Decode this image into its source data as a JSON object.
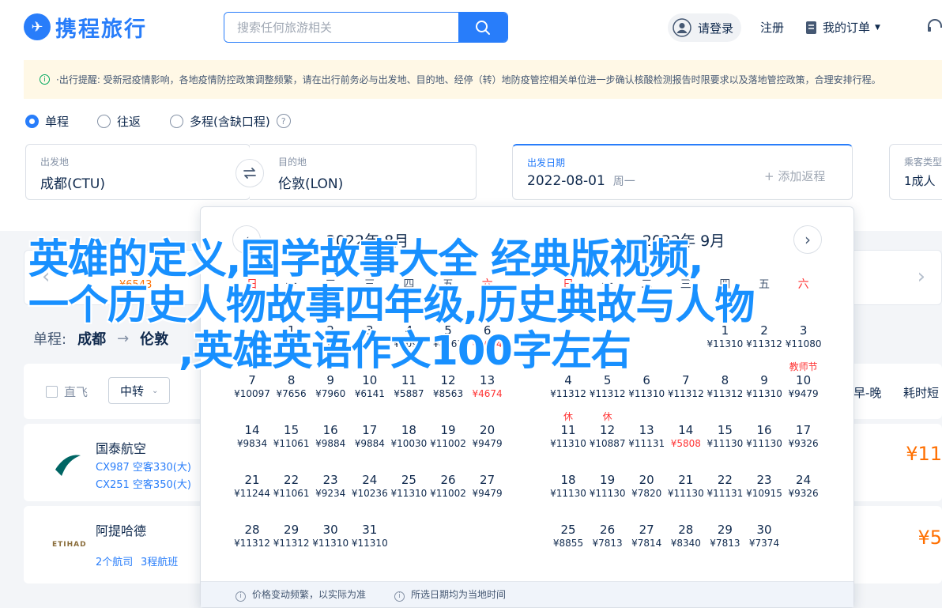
{
  "header": {
    "logo_text": "携程旅行",
    "search_placeholder": "搜索任何旅游相关",
    "login_label": "请登录",
    "register_label": "注册",
    "orders_label": "我的订单"
  },
  "notice": {
    "text": "·出行提醒: 受新冠疫情影响，各地疫情防控政策调整频繁，请在出行前务必与出发地、目的地、经停（转）地防疫管控相关单位进一步确认核酸检测报告时限要求以及落地管控政策，合理安排行程。"
  },
  "trip_type": {
    "options": [
      "单程",
      "往返",
      "多程(含缺口程)"
    ],
    "selected": "单程"
  },
  "search_form": {
    "from_label": "出发地",
    "from_value": "成都(CTU)",
    "to_label": "目的地",
    "to_value": "伦敦(LON)",
    "date_label": "出发日期",
    "date_value": "2022-08-01",
    "date_weekday": "周一",
    "add_return": "+ 添加返程",
    "passengers_label": "乘客类型",
    "passengers_value": "1成人"
  },
  "background": {
    "strip_price": "¥6543",
    "summary_prefix": "单程:",
    "summary_from": "成都",
    "summary_to": "伦敦",
    "filter_direct": "直飞",
    "filter_transfer": "中转",
    "sort_early_late": "早-晚",
    "sort_duration": "耗时短",
    "flights": [
      {
        "airline": "国泰航空",
        "line1": "CX987 空客330(大)",
        "line2": "CX251 空客350(大)",
        "price": "¥11"
      },
      {
        "airline": "阿提哈德",
        "line1": "2个航司",
        "line2": "3程航班",
        "price": "¥5"
      }
    ]
  },
  "calendar": {
    "months": [
      {
        "title": "2022年 8月",
        "weekdays": [
          "日",
          "一",
          "二",
          "三",
          "四",
          "五",
          "六"
        ],
        "first_weekday": 1,
        "days": [
          {
            "d": "1",
            "p": "¥",
            "low": false
          },
          {
            "d": "2",
            "p": "¥",
            "low": false
          },
          {
            "d": "3",
            "p": "¥",
            "low": false
          },
          {
            "d": "4",
            "p": "¥5098",
            "low": false
          },
          {
            "d": "5",
            "p": "¥8563",
            "low": false
          },
          {
            "d": "6",
            "p": "¥4674",
            "low": true
          },
          {
            "d": "7",
            "p": "¥10097",
            "low": false
          },
          {
            "d": "8",
            "p": "¥7656",
            "low": false
          },
          {
            "d": "9",
            "p": "¥7960",
            "low": false
          },
          {
            "d": "10",
            "p": "¥6141",
            "low": false
          },
          {
            "d": "11",
            "p": "¥5887",
            "low": false
          },
          {
            "d": "12",
            "p": "¥8563",
            "low": false
          },
          {
            "d": "13",
            "p": "¥4674",
            "low": true
          },
          {
            "d": "14",
            "p": "¥9834",
            "low": false
          },
          {
            "d": "15",
            "p": "¥11061",
            "low": false
          },
          {
            "d": "16",
            "p": "¥9884",
            "low": false
          },
          {
            "d": "17",
            "p": "¥9884",
            "low": false
          },
          {
            "d": "18",
            "p": "¥10030",
            "low": false
          },
          {
            "d": "19",
            "p": "¥11002",
            "low": false
          },
          {
            "d": "20",
            "p": "¥9479",
            "low": false
          },
          {
            "d": "21",
            "p": "¥11244",
            "low": false
          },
          {
            "d": "22",
            "p": "¥11061",
            "low": false
          },
          {
            "d": "23",
            "p": "¥9234",
            "low": false
          },
          {
            "d": "24",
            "p": "¥10236",
            "low": false
          },
          {
            "d": "25",
            "p": "¥11310",
            "low": false
          },
          {
            "d": "26",
            "p": "¥11002",
            "low": false
          },
          {
            "d": "27",
            "p": "¥9479",
            "low": false
          },
          {
            "d": "28",
            "p": "¥11312",
            "low": false
          },
          {
            "d": "29",
            "p": "¥11312",
            "low": false
          },
          {
            "d": "30",
            "p": "¥11310",
            "low": false
          },
          {
            "d": "31",
            "p": "¥11310",
            "low": false
          }
        ]
      },
      {
        "title": "2022年 9月",
        "weekdays": [
          "日",
          "一",
          "二",
          "三",
          "四",
          "五",
          "六"
        ],
        "first_weekday": 4,
        "days": [
          {
            "d": "1",
            "p": "¥11310",
            "low": false
          },
          {
            "d": "2",
            "p": "¥11312",
            "low": false
          },
          {
            "d": "3",
            "p": "¥11080",
            "low": false
          },
          {
            "d": "4",
            "p": "¥11312",
            "low": false
          },
          {
            "d": "5",
            "p": "¥11312",
            "low": false
          },
          {
            "d": "6",
            "p": "¥11310",
            "low": false
          },
          {
            "d": "7",
            "p": "¥11312",
            "low": false
          },
          {
            "d": "8",
            "p": "¥11312",
            "low": false
          },
          {
            "d": "9",
            "p": "¥11310",
            "low": false
          },
          {
            "d": "10",
            "p": "¥9479",
            "low": false,
            "tag": "教师节"
          },
          {
            "d": "11",
            "p": "¥11310",
            "low": false,
            "tag": "休"
          },
          {
            "d": "12",
            "p": "¥10887",
            "low": false,
            "tag": "休"
          },
          {
            "d": "13",
            "p": "¥11131",
            "low": false
          },
          {
            "d": "14",
            "p": "¥5808",
            "low": true
          },
          {
            "d": "15",
            "p": "¥11130",
            "low": false
          },
          {
            "d": "16",
            "p": "¥11130",
            "low": false
          },
          {
            "d": "17",
            "p": "¥9326",
            "low": false
          },
          {
            "d": "18",
            "p": "¥11130",
            "low": false
          },
          {
            "d": "19",
            "p": "¥11130",
            "low": false
          },
          {
            "d": "20",
            "p": "¥7820",
            "low": false
          },
          {
            "d": "21",
            "p": "¥11130",
            "low": false
          },
          {
            "d": "22",
            "p": "¥11131",
            "low": false
          },
          {
            "d": "23",
            "p": "¥10915",
            "low": false
          },
          {
            "d": "24",
            "p": "¥9326",
            "low": false
          },
          {
            "d": "25",
            "p": "¥8855",
            "low": false
          },
          {
            "d": "26",
            "p": "¥7813",
            "low": false
          },
          {
            "d": "27",
            "p": "¥7814",
            "low": false
          },
          {
            "d": "28",
            "p": "¥8340",
            "low": false
          },
          {
            "d": "29",
            "p": "¥7813",
            "low": false
          },
          {
            "d": "30",
            "p": "¥7374",
            "low": false
          }
        ]
      }
    ],
    "footer_note1": "价格变动频繁，以实际为准",
    "footer_note2": "所选日期均为当地时间"
  },
  "overlay": {
    "line1": "英雄的定义,国学故事大全 经典版视频,",
    "line2": "一个历史人物故事四年级,历史典故与人物",
    "line3": ",英雄英语作文100字左右"
  },
  "colors": {
    "accent": "#287dfa",
    "price_low": "#ff3434",
    "notice_bg": "#fff8e6",
    "overlay_text": "#1890ff"
  }
}
